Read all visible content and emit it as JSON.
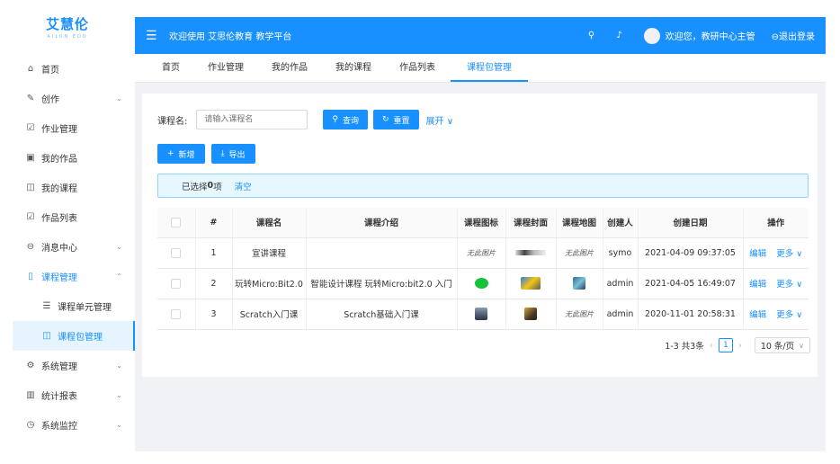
{
  "logo": {
    "brand": "艾慧伦",
    "sub": "AILUN EDU"
  },
  "sidebar": {
    "items": [
      {
        "label": "首页",
        "icon": "home-icon",
        "glyph": "⌂"
      },
      {
        "label": "创作",
        "icon": "pen-icon",
        "glyph": "✎",
        "arrow": "⌄"
      },
      {
        "label": "作业管理",
        "icon": "edit-icon",
        "glyph": "☑"
      },
      {
        "label": "我的作品",
        "icon": "picture-icon",
        "glyph": "▣"
      },
      {
        "label": "我的课程",
        "icon": "book-icon",
        "glyph": "◫"
      },
      {
        "label": "作品列表",
        "icon": "edit-icon",
        "glyph": "☑"
      },
      {
        "label": "消息中心",
        "icon": "message-icon",
        "glyph": "⊖",
        "arrow": "⌄"
      },
      {
        "label": "课程管理",
        "icon": "file-icon",
        "glyph": "▯",
        "arrow": "⌃"
      },
      {
        "label": "课程单元管理",
        "icon": "list-icon",
        "glyph": "☰"
      },
      {
        "label": "课程包管理",
        "icon": "book-icon",
        "glyph": "◫"
      },
      {
        "label": "系统管理",
        "icon": "gear-icon",
        "glyph": "⚙",
        "arrow": "⌄"
      },
      {
        "label": "统计报表",
        "icon": "bar-chart-icon",
        "glyph": "▥",
        "arrow": "⌄"
      },
      {
        "label": "系统监控",
        "icon": "dashboard-icon",
        "glyph": "◷",
        "arrow": "⌄"
      }
    ]
  },
  "header": {
    "fold_glyph": "☰",
    "title": "欢迎使用 艾思伦教育 教学平台",
    "search_glyph": "⚲",
    "bell_glyph": "♪",
    "greeting": "欢迎您，教研中心主管",
    "logout": "⊖退出登录"
  },
  "tabs": [
    "首页",
    "作业管理",
    "我的作品",
    "我的课程",
    "作品列表",
    "课程包管理"
  ],
  "search": {
    "label": "课程名:",
    "placeholder": "请输入课程名",
    "query_label": "查询",
    "query_glyph": "⚲",
    "reset_label": "重置",
    "reset_glyph": "↻",
    "expand_label": "展开 ∨"
  },
  "actions": {
    "add_label": "新增",
    "add_glyph": "+",
    "export_label": "导出",
    "export_glyph": "⤓"
  },
  "alert": {
    "prefix": "已选择 ",
    "count": "0",
    "suffix": "项",
    "clear": "清空"
  },
  "table": {
    "headers": [
      "#",
      "课程名",
      "课程介绍",
      "课程图标",
      "课程封面",
      "课程地图",
      "创建人",
      "创建日期",
      "操作"
    ],
    "rows": [
      {
        "index": "1",
        "name": "宣讲课程",
        "intro": "",
        "icon_text": "无此图片",
        "map_text": "无此图片",
        "creator": "symo",
        "date": "2021-04-09 09:37:05"
      },
      {
        "index": "2",
        "name": "玩转Micro:Bit2.0",
        "intro": "智能设计课程 玩转Micro:bit2.0 入门",
        "creator": "admin",
        "date": "2021-04-05 16:49:07"
      },
      {
        "index": "3",
        "name": "Scratch入门课",
        "intro": "Scratch基础入门课",
        "map_text": "无此图片",
        "creator": "admin",
        "date": "2020-11-01 20:58:31"
      }
    ],
    "edit_label": "编辑",
    "more_label": "更多 ∨"
  },
  "pager": {
    "summary": "1-3 共3条",
    "prev": "‹",
    "page": "1",
    "next": "›",
    "size": "10 条/页",
    "size_chev": "∨"
  }
}
